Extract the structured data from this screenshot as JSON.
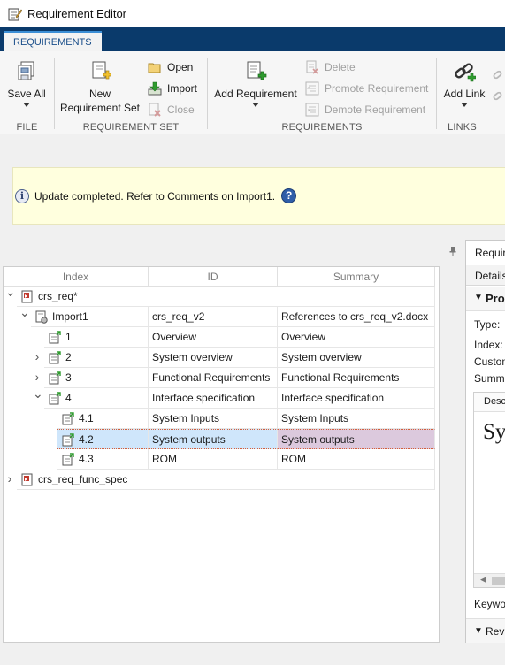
{
  "window": {
    "title": "Requirement Editor"
  },
  "tabs": [
    {
      "label": "REQUIREMENTS"
    }
  ],
  "ribbon": {
    "file": {
      "label": "FILE",
      "save_all": "Save All"
    },
    "requirement_set": {
      "label": "REQUIREMENT SET",
      "new_line1": "New",
      "new_line2": "Requirement Set",
      "open": "Open",
      "import": "Import",
      "close": "Close"
    },
    "requirements": {
      "label": "REQUIREMENTS",
      "add": "Add Requirement",
      "delete": "Delete",
      "promote": "Promote Requirement",
      "demote": "Demote Requirement"
    },
    "links": {
      "label": "LINKS",
      "add_link": "Add Link"
    }
  },
  "notification": {
    "message": "Update completed. Refer to Comments on Import1.",
    "help": "?"
  },
  "tree": {
    "columns": [
      "Index",
      "ID",
      "Summary"
    ],
    "rows": [
      {
        "index": "crs_req*",
        "id": "",
        "summary": "",
        "level": 0,
        "expander": "open",
        "icon": "requirement-set-icon"
      },
      {
        "index": "Import1",
        "id": "crs_req_v2",
        "summary": "References to crs_req_v2.docx",
        "level": 1,
        "expander": "open",
        "icon": "import-node-icon"
      },
      {
        "index": "1",
        "id": "Overview",
        "summary": "Overview",
        "level": 2,
        "expander": "none",
        "icon": "reference-icon"
      },
      {
        "index": "2",
        "id": "System overview",
        "summary": "System overview",
        "level": 2,
        "expander": "closed",
        "icon": "reference-icon"
      },
      {
        "index": "3",
        "id": "Functional Requirements",
        "summary": "Functional Requirements",
        "level": 2,
        "expander": "closed",
        "icon": "reference-icon"
      },
      {
        "index": "4",
        "id": "Interface specification",
        "summary": "Interface specification",
        "level": 2,
        "expander": "open",
        "icon": "reference-icon"
      },
      {
        "index": "4.1",
        "id": "System Inputs",
        "summary": "System Inputs",
        "level": 3,
        "expander": "none",
        "icon": "reference-icon"
      },
      {
        "index": "4.2",
        "id": "System outputs",
        "summary": "System outputs",
        "level": 3,
        "expander": "none",
        "icon": "reference-icon",
        "selected": true
      },
      {
        "index": "4.3",
        "id": "ROM",
        "summary": "ROM",
        "level": 3,
        "expander": "none",
        "icon": "reference-icon"
      },
      {
        "index": "crs_req_func_spec",
        "id": "",
        "summary": "",
        "level": 0,
        "expander": "closed",
        "icon": "requirement-set-icon"
      }
    ]
  },
  "right_panel": {
    "tab": "Requirement",
    "details_tab": "Details",
    "section": "Properties",
    "type_label": "Type:",
    "index_label": "Index:",
    "custom_label": "Custom ID:",
    "summary_label": "Summary:",
    "description_tab": "Description",
    "description_text": "System outputs",
    "keywords_label": "Keywords:",
    "revision_label": "Revision"
  },
  "colors": {
    "tab_bar": "#0a3a6b",
    "selection": "#cfe6fb",
    "selection_summary": "#dcc9dd",
    "notification_bg": "#ffffde"
  }
}
